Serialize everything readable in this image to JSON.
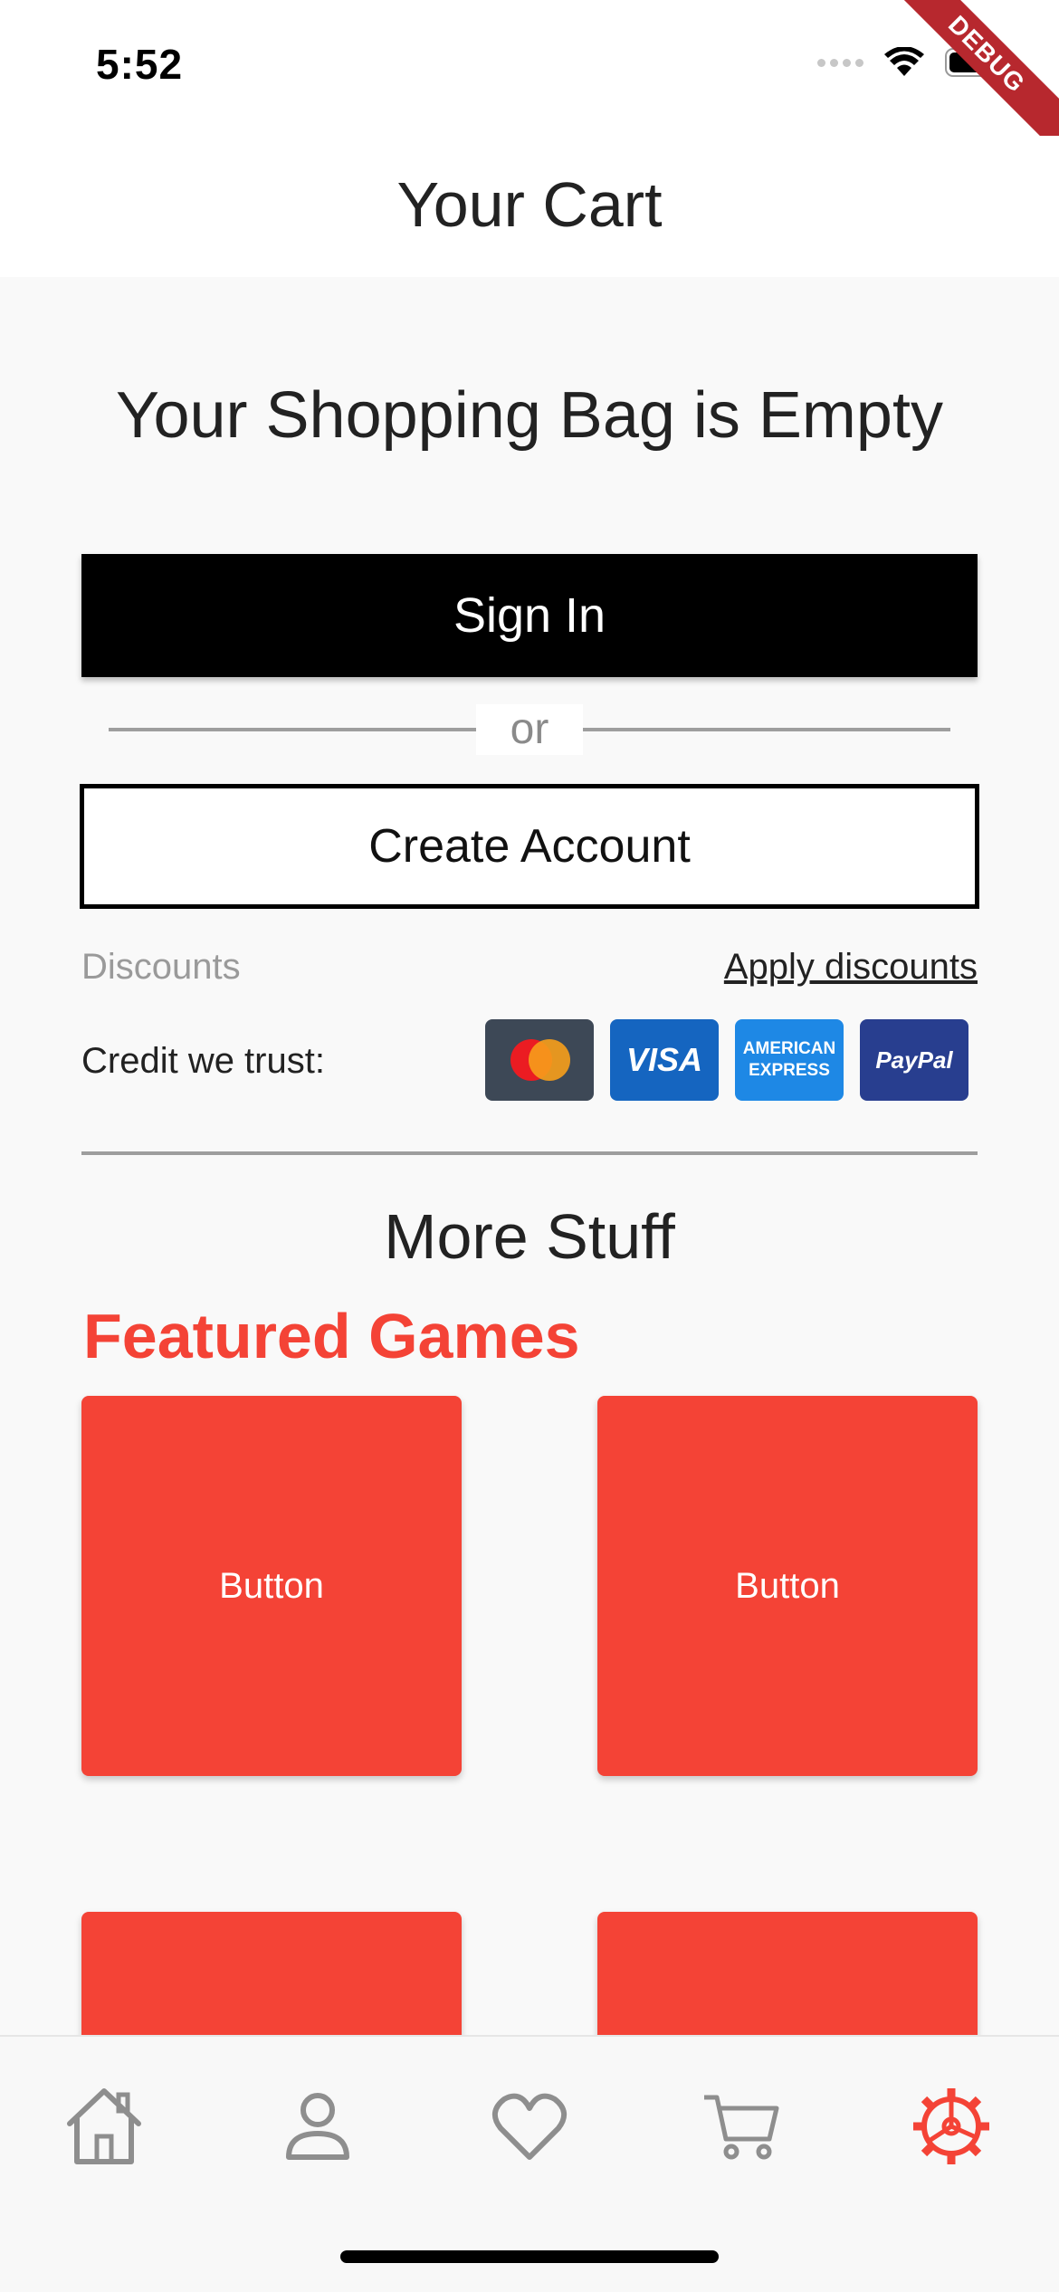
{
  "status_bar": {
    "time": "5:52",
    "debug_label": "DEBUG"
  },
  "app_bar": {
    "title": "Your Cart"
  },
  "cart": {
    "empty_message": "Your Shopping Bag is Empty",
    "sign_in_label": "Sign In",
    "or_label": "or",
    "create_account_label": "Create Account",
    "discounts_label": "Discounts",
    "apply_discounts_label": "Apply discounts",
    "credit_label": "Credit we trust:",
    "cards": [
      {
        "name": "mastercard",
        "label": ""
      },
      {
        "name": "visa",
        "label": "VISA"
      },
      {
        "name": "amex",
        "label_line1": "AMERICAN",
        "label_line2": "EXPRESS"
      },
      {
        "name": "paypal",
        "label": "PayPal"
      }
    ]
  },
  "more": {
    "title": "More Stuff",
    "featured_title": "Featured Games",
    "tiles": [
      "Button",
      "Button",
      "",
      ""
    ]
  },
  "tab_bar": {
    "items": [
      {
        "name": "home",
        "icon": "home-icon",
        "active": false
      },
      {
        "name": "profile",
        "icon": "person-icon",
        "active": false
      },
      {
        "name": "favorites",
        "icon": "heart-icon",
        "active": false
      },
      {
        "name": "cart",
        "icon": "cart-icon",
        "active": false
      },
      {
        "name": "settings",
        "icon": "gear-icon",
        "active": true
      }
    ],
    "active_color": "#f44336",
    "inactive_color": "#8e8e8e"
  },
  "colors": {
    "accent": "#f44336",
    "primary_button": "#000000"
  }
}
